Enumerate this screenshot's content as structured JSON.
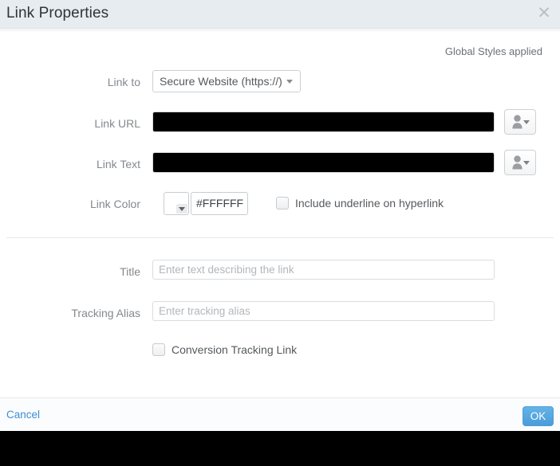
{
  "dialog": {
    "title": "Link Properties",
    "close_icon": "close-icon",
    "global_styles_note": "Global Styles applied"
  },
  "form": {
    "link_to": {
      "label": "Link to",
      "selected": "Secure Website (https://)",
      "caret_icon": "chevron-down-icon"
    },
    "link_url": {
      "label": "Link URL",
      "value": "",
      "redacted": true,
      "picker_icon": "person-icon",
      "picker_caret_icon": "chevron-down-icon"
    },
    "link_text": {
      "label": "Link Text",
      "value": "",
      "redacted": true,
      "picker_icon": "person-icon",
      "picker_caret_icon": "chevron-down-icon"
    },
    "link_color": {
      "label": "Link Color",
      "swatch_color": "#FFFFFF",
      "hex_value": "#FFFFFF",
      "swatch_caret_icon": "chevron-down-icon"
    },
    "include_underline": {
      "label": "Include underline on hyperlink",
      "checked": false
    },
    "title_field": {
      "label": "Title",
      "value": "",
      "placeholder": "Enter text describing the link"
    },
    "tracking_alias": {
      "label": "Tracking Alias",
      "value": "",
      "placeholder": "Enter tracking alias"
    },
    "conversion_tracking": {
      "label": "Conversion Tracking Link",
      "checked": false
    }
  },
  "footer": {
    "cancel_label": "Cancel",
    "ok_label": "OK"
  },
  "colors": {
    "header_bg": "#E6ECF0",
    "accent_blue": "#4A9CD8",
    "link_blue": "#3B8FD4",
    "label_gray": "#84898E",
    "redaction_black": "#000000"
  }
}
